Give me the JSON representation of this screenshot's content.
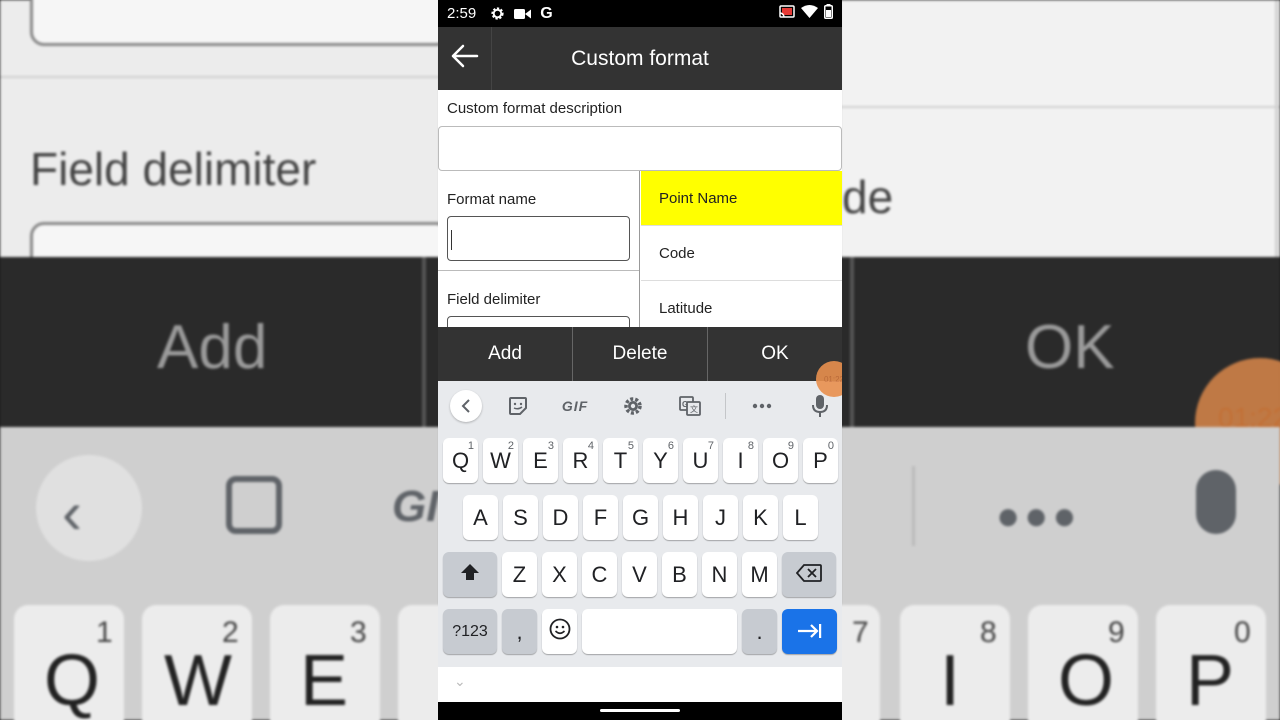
{
  "status_bar": {
    "time": "2:59",
    "icons_left": [
      "gear-icon",
      "video-camera-icon",
      "google-g-icon"
    ],
    "icons_right": [
      "cast-icon",
      "wifi-icon",
      "battery-icon"
    ]
  },
  "app_bar": {
    "title": "Custom format",
    "back_icon": "arrow-left-icon"
  },
  "form": {
    "description_label": "Custom format description",
    "description_value": "",
    "format_name_label": "Format name",
    "format_name_value": "",
    "field_delimiter_label": "Field delimiter"
  },
  "field_list": {
    "items": [
      "Point Name",
      "Code",
      "Latitude"
    ],
    "selected_index": 0,
    "selected_color": "#ffff00"
  },
  "button_bar": {
    "buttons": [
      "Add",
      "Delete",
      "OK"
    ]
  },
  "timer": {
    "label": "01:22",
    "color": "#e8904e"
  },
  "keyboard": {
    "toolbar": {
      "gif_label": "GIF",
      "icons": [
        "chevron-left-icon",
        "sticker-icon",
        "gif-icon",
        "gear-icon",
        "translate-icon",
        "more-icon",
        "mic-icon"
      ]
    },
    "row1": [
      {
        "char": "Q",
        "sup": "1"
      },
      {
        "char": "W",
        "sup": "2"
      },
      {
        "char": "E",
        "sup": "3"
      },
      {
        "char": "R",
        "sup": "4"
      },
      {
        "char": "T",
        "sup": "5"
      },
      {
        "char": "Y",
        "sup": "6"
      },
      {
        "char": "U",
        "sup": "7"
      },
      {
        "char": "I",
        "sup": "8"
      },
      {
        "char": "O",
        "sup": "9"
      },
      {
        "char": "P",
        "sup": "0"
      }
    ],
    "row2": [
      "A",
      "S",
      "D",
      "F",
      "G",
      "H",
      "J",
      "K",
      "L"
    ],
    "row3": [
      "Z",
      "X",
      "C",
      "V",
      "B",
      "N",
      "M"
    ],
    "symbols_label": "?123",
    "comma_label": ",",
    "period_label": ".",
    "accent_color": "#1a73e8"
  },
  "background": {
    "field_delimiter_text": "Field delimiter",
    "code_fragment": "de",
    "add_text": "Add",
    "ok_text": "OK",
    "timer_text": "01:22",
    "keys": [
      {
        "char": "Q",
        "sup": "1"
      },
      {
        "char": "W",
        "sup": "2"
      },
      {
        "char": "E",
        "sup": "3"
      },
      {
        "char": "I",
        "sup": "8"
      },
      {
        "char": "O",
        "sup": "9"
      },
      {
        "char": "P",
        "sup": "0"
      }
    ],
    "partial_sups": [
      "7"
    ],
    "partial_text": "GI"
  }
}
